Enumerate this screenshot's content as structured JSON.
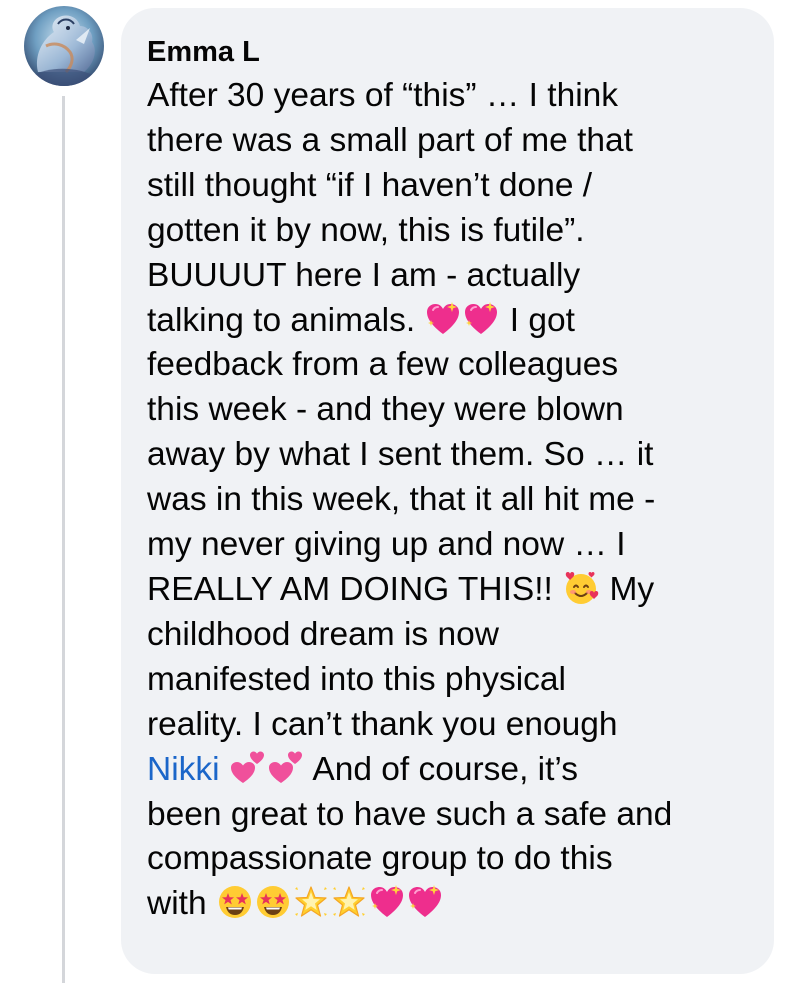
{
  "comment": {
    "author": "Emma L",
    "avatar_icon": "dragon-avatar-icon",
    "colors": {
      "bubble": "#f0f2f5",
      "text": "#050505",
      "mention": "#1b66c9",
      "thread_line": "#d4d6da"
    },
    "lines": [
      "After 30 years of “this” … I think",
      "there was a small part of me that",
      "still thought “if I haven’t done /",
      "gotten it by now, this is futile”.",
      "BUUUUT here I am - actually",
      "talking to animals.",
      "I got",
      "feedback from a few colleagues",
      "this week - and they were blown",
      "away by what I sent them. So … it",
      "was in this week, that it all hit me -",
      "my never giving up and now … I",
      "REALLY AM DOING THIS!!",
      "My",
      "childhood dream is now",
      "manifested into this physical",
      "reality. I can’t thank you enough",
      "Nikki",
      "And of course, it’s",
      "been great to have such a safe and",
      "compassionate group to do this",
      "with"
    ],
    "emojis": {
      "sparkling_heart": "sparkling-heart-emoji",
      "smiling_face_with_hearts": "smiling-face-with-hearts-emoji",
      "two_hearts": "two-hearts-emoji",
      "star_struck": "star-struck-emoji",
      "glowing_star": "glowing-star-emoji"
    }
  }
}
